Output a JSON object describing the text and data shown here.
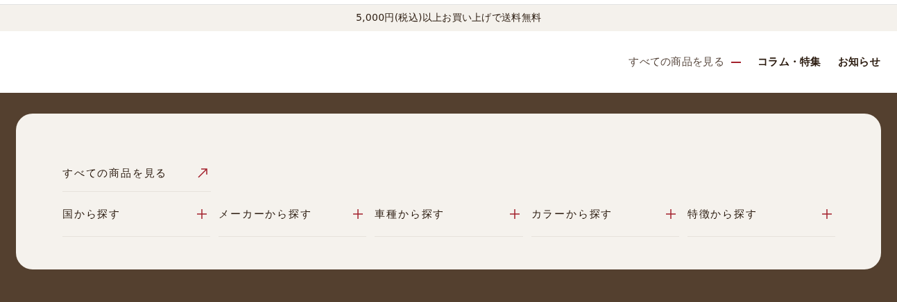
{
  "banner": {
    "text": "5,000円(税込)以上お買い上げで送料無料"
  },
  "nav": [
    {
      "label": "すべての商品を見る",
      "expanded": true
    },
    {
      "label": "コラム・特集",
      "expanded": false
    },
    {
      "label": "お知らせ",
      "expanded": false
    }
  ],
  "menu": {
    "all_link": "すべての商品を見る",
    "categories": [
      {
        "label": "国から探す",
        "expanded": false
      },
      {
        "label": "メーカーから探す",
        "expanded": false
      },
      {
        "label": "車種から探す",
        "expanded": false
      },
      {
        "label": "カラーから探す",
        "expanded": false
      },
      {
        "label": "特徴から探す",
        "expanded": false
      }
    ]
  }
}
